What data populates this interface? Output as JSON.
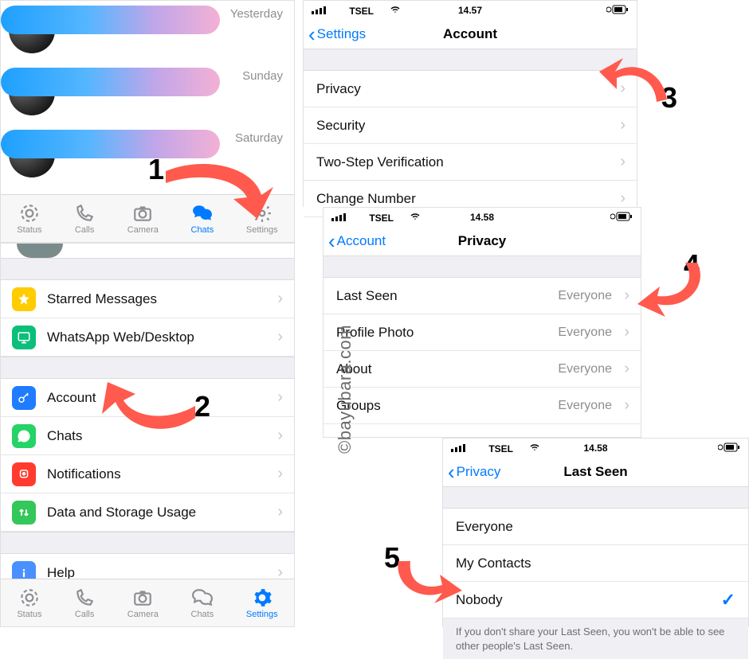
{
  "chats": [
    {
      "time": "Yesterday",
      "sub": ""
    },
    {
      "time": "Sunday",
      "sub": ""
    },
    {
      "time": "Saturday",
      "sub": ""
    }
  ],
  "tabbar": {
    "status": "Status",
    "calls": "Calls",
    "camera": "Camera",
    "chats": "Chats",
    "settings": "Settings"
  },
  "settings_list": {
    "starred": "Starred Messages",
    "web": "WhatsApp Web/Desktop",
    "account": "Account",
    "chats": "Chats",
    "notifications": "Notifications",
    "data": "Data and Storage Usage",
    "help": "Help"
  },
  "account_screen": {
    "status": {
      "carrier": "TSEL",
      "time": "14.57"
    },
    "back": "Settings",
    "title": "Account",
    "rows": {
      "privacy": "Privacy",
      "security": "Security",
      "twostep": "Two-Step Verification",
      "change": "Change Number"
    }
  },
  "privacy_screen": {
    "status": {
      "carrier": "TSEL",
      "time": "14.58"
    },
    "back": "Account",
    "title": "Privacy",
    "rows": {
      "lastseen": {
        "label": "Last Seen",
        "value": "Everyone"
      },
      "photo": {
        "label": "Profile Photo",
        "value": "Everyone"
      },
      "about": {
        "label": "About",
        "value": "Everyone"
      },
      "groups": {
        "label": "Groups",
        "value": "Everyone"
      }
    }
  },
  "lastseen_screen": {
    "status": {
      "carrier": "TSEL",
      "time": "14.58"
    },
    "back": "Privacy",
    "title": "Last Seen",
    "options": {
      "everyone": "Everyone",
      "contacts": "My Contacts",
      "nobody": "Nobody"
    },
    "selected": "nobody",
    "footer": "If you don't share your Last Seen, you won't be able to see other people's Last Seen."
  },
  "watermark": "©bayubara.com",
  "step_numbers": {
    "1": "1",
    "2": "2",
    "3": "3",
    "4": "4",
    "5": "5"
  },
  "colors": {
    "accent": "#007aff",
    "arrow": "#ff5a4d",
    "starred_bg": "#ffcc00",
    "web_bg": "#0bbf7a",
    "account_bg": "#1f7cff",
    "chats_bg": "#25d366",
    "notif_bg": "#ff3b30",
    "data_bg": "#34c759",
    "help_bg": "#4a90ff"
  }
}
